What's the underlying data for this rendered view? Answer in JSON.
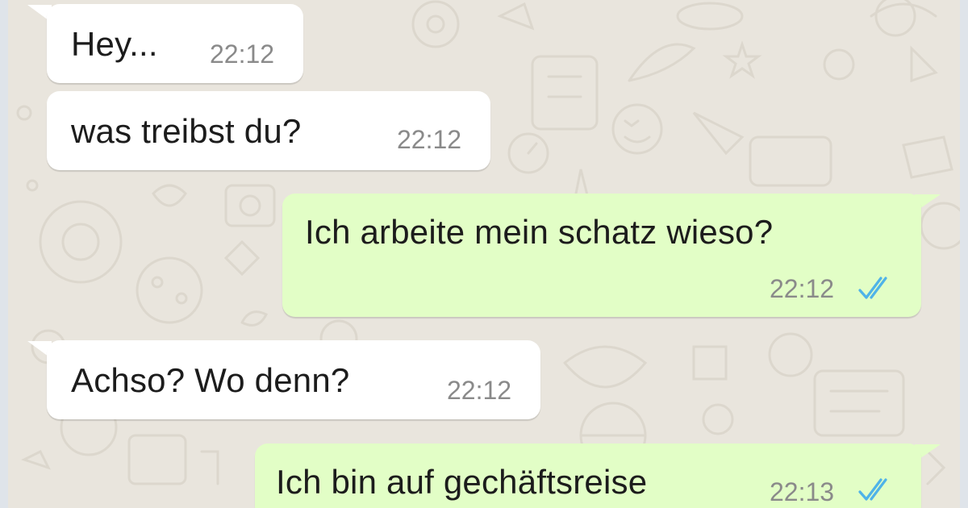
{
  "chat": {
    "messages": [
      {
        "direction": "incoming",
        "text": "Hey...",
        "time": "22:12"
      },
      {
        "direction": "incoming",
        "text": "was treibst du?",
        "time": "22:12"
      },
      {
        "direction": "outgoing",
        "text": "Ich arbeite mein schatz wieso?",
        "time": "22:12",
        "status_icon": "double-check-icon"
      },
      {
        "direction": "incoming",
        "text": "Achso? Wo denn?",
        "time": "22:12"
      },
      {
        "direction": "outgoing",
        "text": "Ich bin auf gechäftsreise",
        "time": "22:13",
        "status_icon": "double-check-icon"
      }
    ]
  },
  "colors": {
    "wallpaper": "#e9e5dd",
    "incoming_bubble": "#ffffff",
    "outgoing_bubble": "#e2fec6",
    "read_check": "#4fb3e8"
  }
}
